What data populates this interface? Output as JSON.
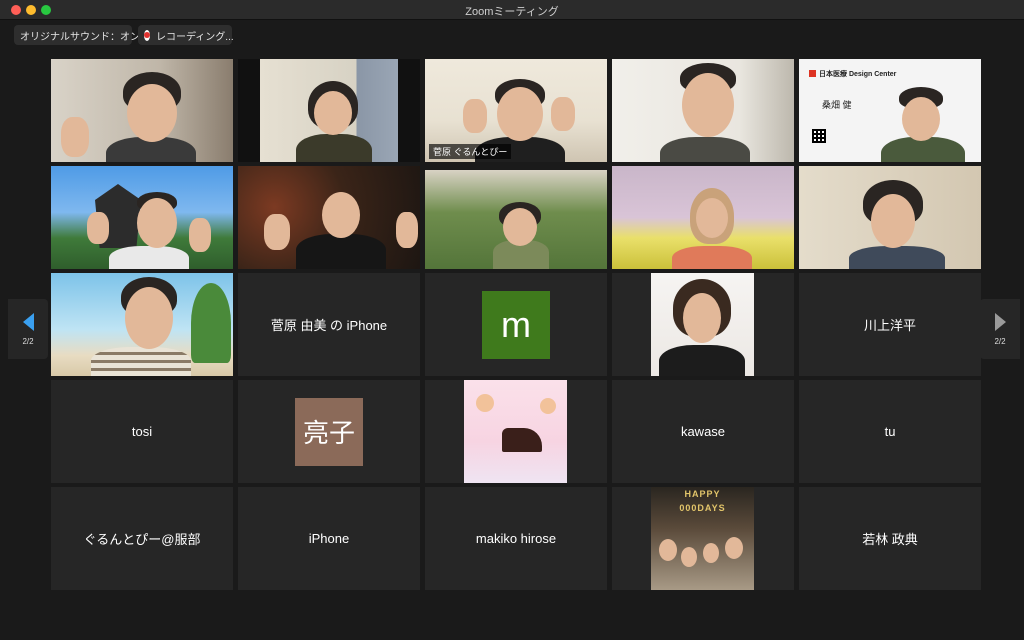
{
  "window": {
    "title": "Zoomミーティング"
  },
  "toolbar": {
    "original_sound_label": "オリジナルサウンド：オン",
    "recording_label": "レコーディング..."
  },
  "pager": {
    "left_count": "2/2",
    "right_count": "2/2"
  },
  "active_speaker_name": "菅原 ぐるんとぴー",
  "business_card": {
    "org": "日本医療 Design Center",
    "name": "桑畑 健"
  },
  "participants": {
    "sugawara_iphone": "菅原 由美 の iPhone",
    "m_avatar": "m",
    "kawakami": "川上洋平",
    "tosi": "tosi",
    "ryoko": "亮子",
    "kawase": "kawase",
    "tu": "tu",
    "hattori": "ぐるんとぴー@服部",
    "iphone": "iPhone",
    "makiko": "makiko hirose",
    "wakabayashi": "若林 政典"
  },
  "happy_banner": {
    "line1": "HAPPY",
    "line2": "000DAYS"
  },
  "colors": {
    "active_outline": "#c6d95a",
    "avatar_m": "#3f7a1c",
    "avatar_ryoko": "#8b6a59",
    "pager_arrow": "#3aa0f0"
  }
}
